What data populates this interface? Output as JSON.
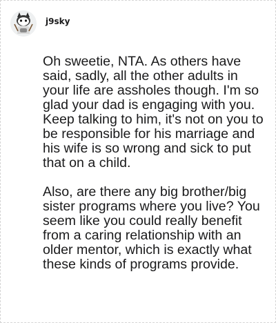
{
  "comment": {
    "username": "j9sky",
    "avatar_icon": "snoo-avatar-icon",
    "paragraphs": [
      "Oh sweetie, NTA. As others have said, sadly, all the other adults in your life are assholes though. I'm so glad your dad is engaging with you. Keep talking to him, it's not on you to be responsible for his marriage and his wife is so wrong and sick to put that on a child.",
      "Also, are there any big brother/big sister programs where you live? You seem like you could really benefit from a caring relationship with an older mentor, which is exactly what these kinds of programs provide."
    ]
  }
}
